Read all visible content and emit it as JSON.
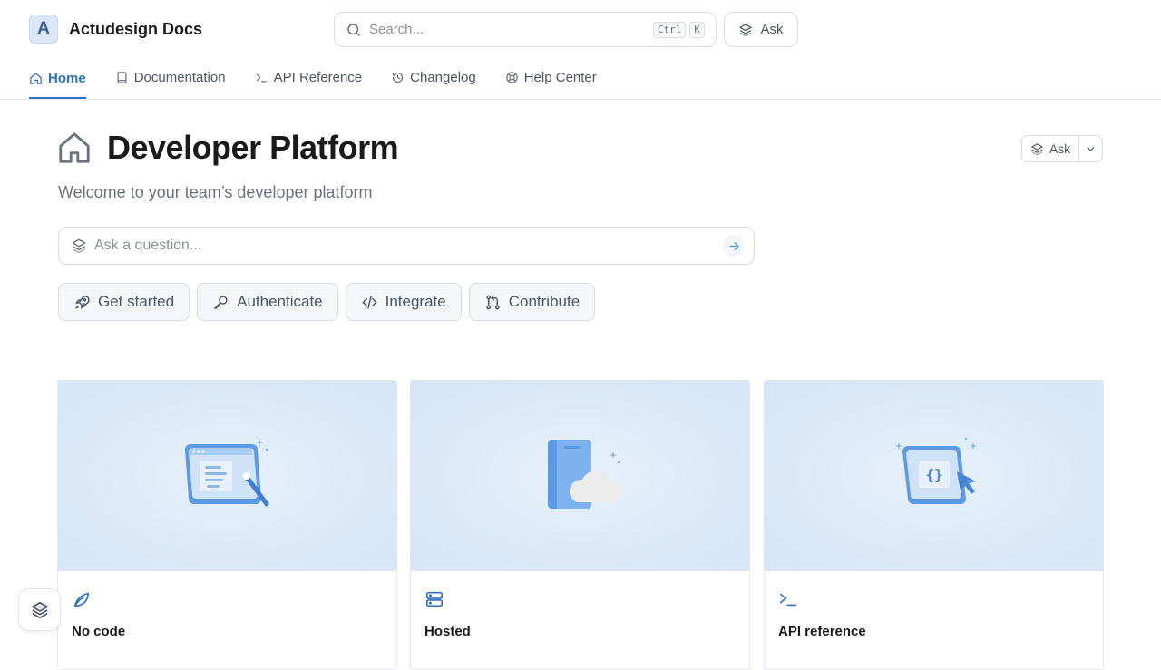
{
  "header": {
    "brand_letter": "A",
    "brand_name": "Actudesign Docs",
    "search_placeholder": "Search...",
    "search_shortcut": [
      "Ctrl",
      "K"
    ],
    "ask_label": "Ask"
  },
  "nav": {
    "tabs": [
      {
        "label": "Home",
        "icon": "home-icon",
        "active": true
      },
      {
        "label": "Documentation",
        "icon": "book-icon",
        "active": false
      },
      {
        "label": "API Reference",
        "icon": "terminal-icon",
        "active": false
      },
      {
        "label": "Changelog",
        "icon": "history-icon",
        "active": false
      },
      {
        "label": "Help Center",
        "icon": "lifebuoy-icon",
        "active": false
      }
    ]
  },
  "main": {
    "title": "Developer Platform",
    "subtitle": "Welcome to your team’s developer platform",
    "ask_label": "Ask",
    "question_placeholder": "Ask a question...",
    "chips": [
      {
        "label": "Get started",
        "icon": "rocket-icon"
      },
      {
        "label": "Authenticate",
        "icon": "key-icon"
      },
      {
        "label": "Integrate",
        "icon": "code-icon"
      },
      {
        "label": "Contribute",
        "icon": "git-pull-request-icon"
      }
    ],
    "cards": [
      {
        "title": "No code",
        "icon": "leaf-icon"
      },
      {
        "title": "Hosted",
        "icon": "server-icon"
      },
      {
        "title": "API reference",
        "icon": "terminal-icon"
      }
    ]
  },
  "colors": {
    "accent": "#2f6fc4",
    "hero_bg": "#dbe9f8",
    "text_muted": "#6b7280"
  }
}
